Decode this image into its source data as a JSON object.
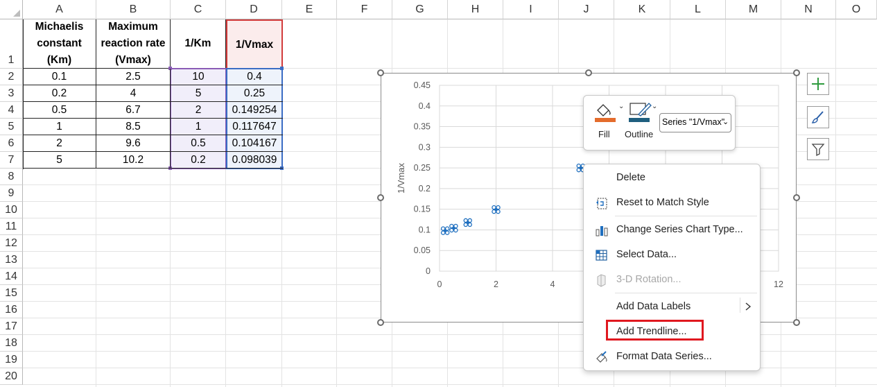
{
  "columns": [
    "A",
    "B",
    "C",
    "D",
    "E",
    "F",
    "G",
    "H",
    "I",
    "J",
    "K",
    "L",
    "M",
    "N",
    "O"
  ],
  "rows": [
    "1",
    "2",
    "3",
    "4",
    "5",
    "6",
    "7",
    "8",
    "9",
    "10",
    "11",
    "12",
    "13",
    "14",
    "15",
    "16",
    "17",
    "18",
    "19",
    "20"
  ],
  "table": {
    "headers": [
      "Michaelis constant (Km)",
      "Maximum reaction rate (Vmax)",
      "1/Km",
      "1/Vmax"
    ],
    "header_lines": {
      "a": [
        "Michaelis",
        "constant",
        "(Km)"
      ],
      "b": [
        "Maximum",
        "reaction rate",
        "(Vmax)"
      ],
      "c": "1/Km",
      "d": "1/Vmax"
    },
    "data": [
      [
        "0.1",
        "2.5",
        "10",
        "0.4"
      ],
      [
        "0.2",
        "4",
        "5",
        "0.25"
      ],
      [
        "0.5",
        "6.7",
        "2",
        "0.149254"
      ],
      [
        "1",
        "8.5",
        "1",
        "0.117647"
      ],
      [
        "2",
        "9.6",
        "0.5",
        "0.104167"
      ],
      [
        "5",
        "10.2",
        "0.2",
        "0.098039"
      ]
    ]
  },
  "chart_data": {
    "type": "scatter",
    "ylabel": "1/Vmax",
    "xlabel": "",
    "xlim": [
      0,
      12
    ],
    "ylim": [
      0,
      0.45
    ],
    "x_ticks": [
      "0",
      "2",
      "4",
      "12"
    ],
    "y_ticks": [
      "0",
      "0.05",
      "0.1",
      "0.15",
      "0.2",
      "0.25",
      "0.3",
      "0.35",
      "0.4",
      "0.45"
    ],
    "series": [
      {
        "name": "1/Vmax",
        "x": [
          0.2,
          0.5,
          1,
          2,
          5,
          10
        ],
        "y": [
          0.098039,
          0.104167,
          0.117647,
          0.149254,
          0.25,
          0.4
        ]
      }
    ],
    "grid": true,
    "marker_color": "#1f6fbf"
  },
  "mini_toolbar": {
    "fill_label": "Fill",
    "outline_label": "Outline",
    "series_value": "Series \"1/Vmax\"",
    "fill_color": "#e46c2c",
    "outline_color": "#1f5f7f"
  },
  "context_menu": {
    "items": [
      {
        "label": "Delete",
        "icon": "none",
        "disabled": false
      },
      {
        "label": "Reset to Match Style",
        "icon": "reset-style-icon",
        "disabled": false
      },
      {
        "label": "Change Series Chart Type...",
        "icon": "chart-type-icon",
        "disabled": false
      },
      {
        "label": "Select Data...",
        "icon": "select-data-icon",
        "disabled": false
      },
      {
        "label": "3-D Rotation...",
        "icon": "rotation-3d-icon",
        "disabled": true
      },
      {
        "label": "Add Data Labels",
        "icon": "none",
        "disabled": false
      },
      {
        "label": "Add Trendline...",
        "icon": "none",
        "disabled": false
      },
      {
        "label": "Format Data Series...",
        "icon": "format-series-icon",
        "disabled": false
      }
    ]
  },
  "colors": {
    "grid": "#d4d4d4",
    "purple_border": "#8a5bb6",
    "purple_fill": "#f1eefa",
    "blue_border": "#3a6cc4",
    "blue_fill": "#eef3fb",
    "red_border": "#d23b3b",
    "red_fill": "#fbecec",
    "highlight": "#e0181f"
  }
}
